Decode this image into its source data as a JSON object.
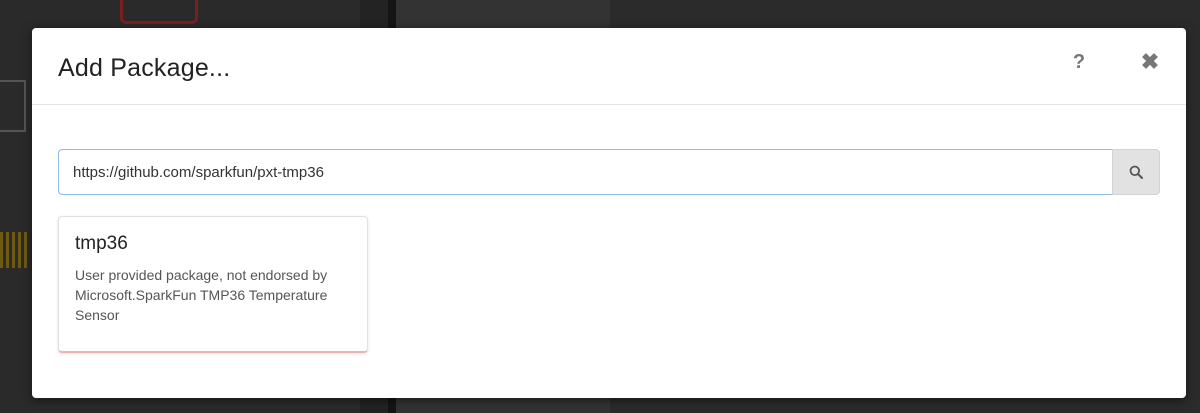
{
  "dialog": {
    "title": "Add Package...",
    "help_label": "?",
    "close_label": "✖"
  },
  "search": {
    "value": "https://github.com/sparkfun/pxt-tmp36",
    "button_icon": "search-icon"
  },
  "results": [
    {
      "name": "tmp36",
      "description": "User provided package, not endorsed by Microsoft.SparkFun TMP36 Temperature Sensor"
    }
  ],
  "colors": {
    "input_focus_border": "#8fbbe6",
    "search_button_bg": "#e2e2e2",
    "card_accent_bottom": "#e8b4b4"
  }
}
